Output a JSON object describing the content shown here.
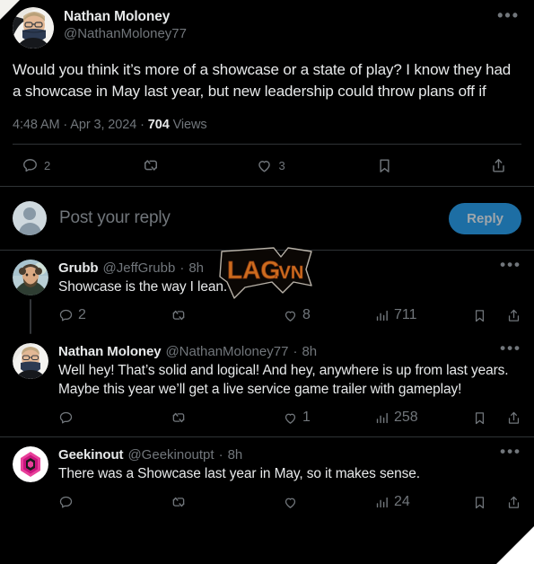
{
  "main_tweet": {
    "author": {
      "display_name": "Nathan Moloney",
      "handle": "@NathanMoloney77",
      "avatar_alt": "avatar-nathan-moloney"
    },
    "text": "Would you think it’s more of a showcase or a state of play? I know they had a showcase in May last year, but new leadership could throw plans off if",
    "meta": {
      "time": "4:48 AM",
      "separator_1": " · ",
      "date": "Apr 3, 2024",
      "separator_2": " · ",
      "views_count": "704",
      "views_label": " Views"
    },
    "more_label": "•••",
    "actions": {
      "reply_count": "2",
      "retweet_count": "",
      "like_count": "3",
      "bookmark_count": "",
      "share_count": ""
    }
  },
  "composer": {
    "placeholder": "Post your reply",
    "reply_button_label": "Reply",
    "avatar_alt": "default-avatar"
  },
  "replies": [
    {
      "display_name": "Grubb",
      "handle": "@JeffGrubb",
      "timestamp_sep": "·",
      "timestamp": "8h",
      "text": "Showcase is the way I lean.",
      "more_label": "•••",
      "actions": {
        "reply_count": "2",
        "retweet_count": "",
        "like_count": "8",
        "views_count": "711"
      },
      "has_thread_line": true
    },
    {
      "display_name": "Nathan Moloney",
      "handle": "@NathanMoloney77",
      "timestamp_sep": "·",
      "timestamp": "8h",
      "text": "Well hey! That’s solid and logical! And hey, anywhere is up from last years. Maybe this year we’ll get a live service game trailer with gameplay!",
      "more_label": "•••",
      "actions": {
        "reply_count": "",
        "retweet_count": "",
        "like_count": "1",
        "views_count": "258"
      },
      "has_thread_line": false
    },
    {
      "display_name": "Geekinout",
      "handle": "@Geekinoutpt",
      "timestamp_sep": "·",
      "timestamp": "8h",
      "text": "There was a Showcase last year in May, so it makes sense.",
      "more_label": "•••",
      "actions": {
        "reply_count": "",
        "retweet_count": "",
        "like_count": "",
        "views_count": "24"
      },
      "has_thread_line": false
    }
  ],
  "watermark": {
    "text": "LAG",
    "suffix": ".VN",
    "color": "#d4701f",
    "outline_color": "#8a3a12"
  },
  "theme": {
    "background": "#000000",
    "text_primary": "#e7e9ea",
    "text_muted": "#71767b",
    "divider": "#2f3336",
    "accent_blue": "#1d6ea4"
  }
}
